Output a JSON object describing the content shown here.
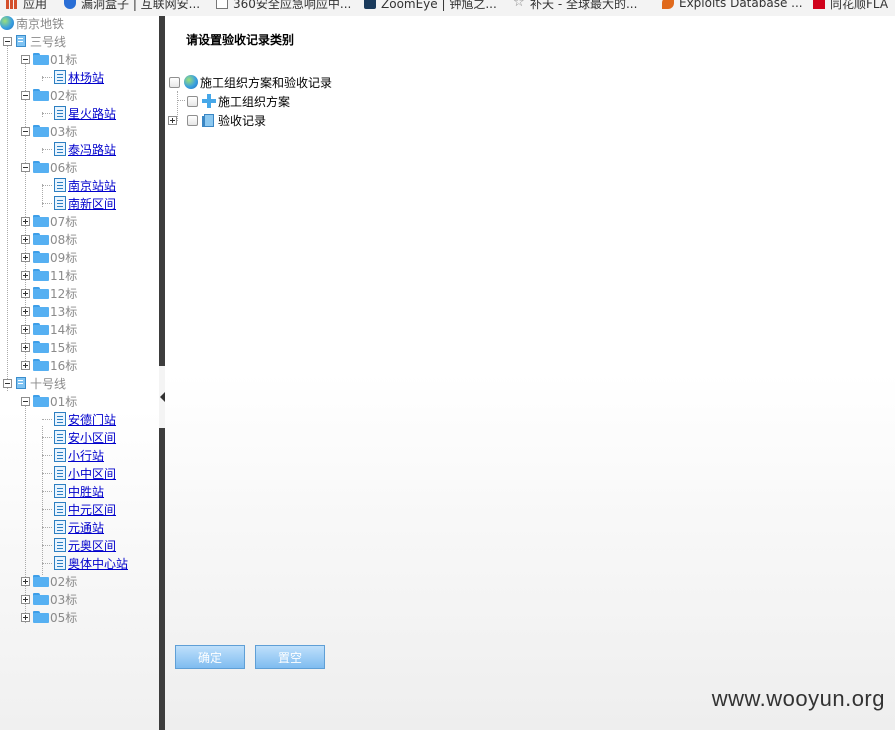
{
  "bookmarks": [
    {
      "icon": "apps-grid-icon",
      "label": "应用"
    },
    {
      "icon": "shield-icon",
      "label": "漏洞盒子 | 互联网安..."
    },
    {
      "icon": "page-icon",
      "label": "360安全应急响应中..."
    },
    {
      "icon": "zoomeye-icon",
      "label": "ZoomEye | 钟馗之..."
    },
    {
      "icon": "star-icon",
      "label": "补天 - 全球最大的..."
    },
    {
      "icon": "exploit-icon",
      "label": "Exploits Database ..."
    },
    {
      "icon": "ths-icon",
      "label": "同花顺FLA"
    }
  ],
  "tree": {
    "root": "南京地铁",
    "lines": [
      {
        "name": "三号线",
        "sections": [
          {
            "name": "01标",
            "expanded": true,
            "stations": [
              "林场站"
            ]
          },
          {
            "name": "02标",
            "expanded": true,
            "stations": [
              "星火路站"
            ]
          },
          {
            "name": "03标",
            "expanded": true,
            "stations": [
              "泰冯路站"
            ]
          },
          {
            "name": "06标",
            "expanded": true,
            "stations": [
              "南京站站",
              "南新区间"
            ]
          },
          {
            "name": "07标",
            "expanded": false,
            "stations": []
          },
          {
            "name": "08标",
            "expanded": false,
            "stations": []
          },
          {
            "name": "09标",
            "expanded": false,
            "stations": []
          },
          {
            "name": "11标",
            "expanded": false,
            "stations": []
          },
          {
            "name": "12标",
            "expanded": false,
            "stations": []
          },
          {
            "name": "13标",
            "expanded": false,
            "stations": []
          },
          {
            "name": "14标",
            "expanded": false,
            "stations": []
          },
          {
            "name": "15标",
            "expanded": false,
            "stations": []
          },
          {
            "name": "16标",
            "expanded": false,
            "stations": []
          }
        ]
      },
      {
        "name": "十号线",
        "sections": [
          {
            "name": "01标",
            "expanded": true,
            "stations": [
              "安德门站",
              "安小区间",
              "小行站",
              "小中区间",
              "中胜站",
              "中元区间",
              "元通站",
              "元奥区间",
              "奥体中心站"
            ]
          },
          {
            "name": "02标",
            "expanded": false,
            "stations": []
          },
          {
            "name": "03标",
            "expanded": false,
            "stations": []
          },
          {
            "name": "05标",
            "expanded": false,
            "stations": []
          }
        ]
      }
    ]
  },
  "main": {
    "title": "请设置验收记录类别",
    "category_root": "施工组织方案和验收记录",
    "categories": [
      "施工组织方案",
      "验收记录"
    ],
    "confirm_label": "确定",
    "clear_label": "置空"
  },
  "watermark": "www.wooyun.org"
}
